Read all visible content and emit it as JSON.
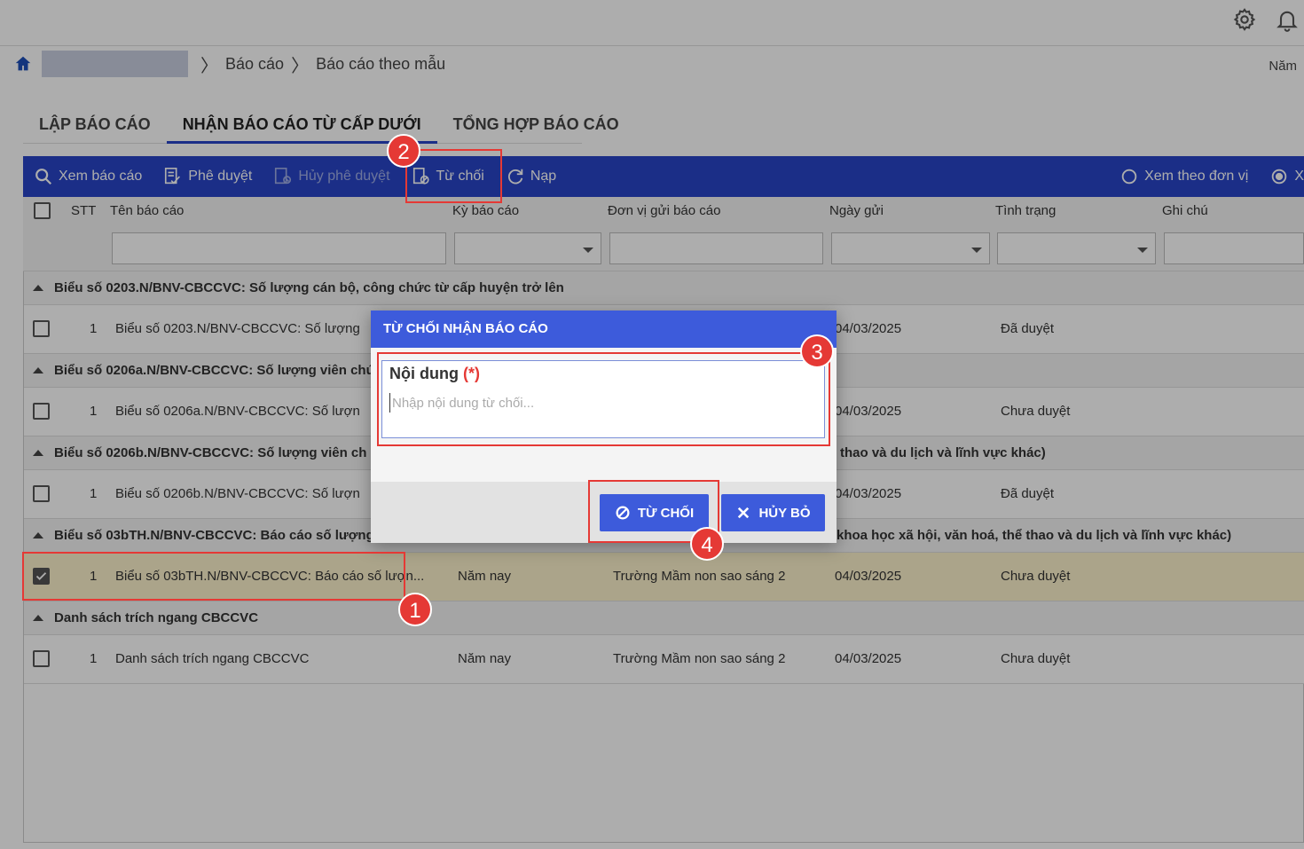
{
  "header": {
    "year_label": "Năm"
  },
  "breadcrumb": {
    "items": [
      "Báo cáo",
      "Báo cáo theo mẫu"
    ]
  },
  "tabs": [
    {
      "label": "LẬP BÁO CÁO"
    },
    {
      "label": "NHẬN BÁO CÁO TỪ CẤP DƯỚI"
    },
    {
      "label": "TỔNG HỢP BÁO CÁO"
    }
  ],
  "toolbar": {
    "view_report": "Xem báo cáo",
    "approve": "Phê duyệt",
    "cancel_approve": "Hủy phê duyệt",
    "reject": "Từ chối",
    "reload": "Nạp",
    "view_by_unit": "Xem theo đơn vị",
    "view_other": "X"
  },
  "columns": {
    "stt": "STT",
    "name": "Tên báo cáo",
    "period": "Kỳ báo cáo",
    "sender": "Đơn vị gửi báo cáo",
    "date": "Ngày gửi",
    "status": "Tình trạng",
    "note": "Ghi chú"
  },
  "groups": [
    {
      "title": "Biểu số 0203.N/BNV-CBCCVC: Số lượng cán bộ, công chức từ cấp huyện trở lên",
      "row": {
        "stt": "1",
        "name": "Biểu số 0203.N/BNV-CBCCVC: Số lượng",
        "period": "",
        "sender": "",
        "date": "04/03/2025",
        "status": "Đã duyệt"
      }
    },
    {
      "title": "Biểu số 0206a.N/BNV-CBCCVC: Số lượng viên chức",
      "row": {
        "stt": "1",
        "name": "Biểu số 0206a.N/BNV-CBCCVC: Số lượn",
        "period": "",
        "sender": "",
        "date": "04/03/2025",
        "status": "Chưa duyệt"
      }
    },
    {
      "title": "Biểu số 0206b.N/BNV-CBCCVC: Số lượng viên ch",
      "title_tail": "thao và du lịch và lĩnh vực khác)",
      "row": {
        "stt": "1",
        "name": "Biểu số 0206b.N/BNV-CBCCVC: Số lượn",
        "period": "",
        "sender": "",
        "date": "04/03/2025",
        "status": "Đã duyệt"
      }
    },
    {
      "title": "Biểu số 03bTH.N/BNV-CBCCVC: Báo cáo số lượng",
      "title_tail": "khoa học xã hội, văn hoá, thể thao và du lịch và lĩnh vực khác)",
      "row": {
        "stt": "1",
        "name": "Biểu số 03bTH.N/BNV-CBCCVC: Báo cáo số lượn...",
        "period": "Năm nay",
        "sender": "Trường Mầm non sao sáng 2",
        "date": "04/03/2025",
        "status": "Chưa duyệt"
      }
    },
    {
      "title": "Danh sách trích ngang CBCCVC",
      "row": {
        "stt": "1",
        "name": "Danh sách trích ngang CBCCVC",
        "period": "Năm nay",
        "sender": "Trường Mầm non sao sáng 2",
        "date": "04/03/2025",
        "status": "Chưa duyệt"
      }
    }
  ],
  "dialog": {
    "title": "TỪ CHỐI NHẬN BÁO CÁO",
    "field_label": "Nội dung",
    "required_mark": "(*)",
    "placeholder": "Nhập nội dung từ chối...",
    "reject_button": "TỪ CHỐI",
    "cancel_button": "HỦY BỎ"
  },
  "annotations": [
    "1",
    "2",
    "3",
    "4"
  ],
  "colors": {
    "primary": "#2845c7",
    "dialog_header": "#3d5bdb",
    "highlight": "#e53935",
    "selected_row": "#fdf2cc"
  }
}
